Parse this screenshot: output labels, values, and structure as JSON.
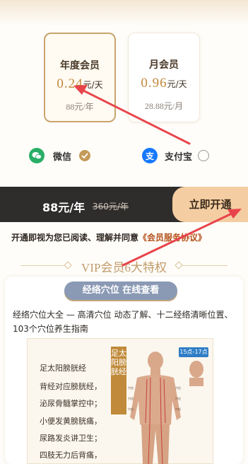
{
  "plans": [
    {
      "name": "年度会员",
      "price_num": "0.24",
      "price_unit": "元/天",
      "orig": "88元/年",
      "selected": true
    },
    {
      "name": "月会员",
      "price_num": "0.96",
      "price_unit": "元/天",
      "orig": "28.88元/月",
      "selected": false
    }
  ],
  "payment": {
    "wechat": {
      "label": "微信",
      "icon": "wechat-icon",
      "checked": true
    },
    "alipay": {
      "label": "支付宝",
      "icon_glyph": "支",
      "checked": false
    }
  },
  "purchase": {
    "price": "88元/年",
    "orig": "360元/年",
    "button": "立即开通"
  },
  "agreement": {
    "text": "开通即视为您已阅读、理解并同意",
    "link": "《会员服务协议》"
  },
  "privileges": {
    "title": "VIP会员6大特权"
  },
  "feature": {
    "pill": "经络穴位  在线查看",
    "description": "经络穴位大全 — 高清穴位  动态了解、十二经络清晰位置、103个穴位养生指南",
    "poster": {
      "lines": [
        "足太阳膀胱经",
        "背经对应膀胱经，",
        "泌尿骨髓掌控中；",
        "小便发黄膀胱痛，",
        "尿路发炎讲卫生；",
        "四肢无力后背痛，"
      ],
      "vertical_title": "足太阳膀胱经",
      "time_tag": "15点-17点"
    }
  },
  "colors": {
    "accent_gold": "#c9a46d",
    "price": "#c2893d",
    "dark_bar": "#2f2c2c",
    "cta": "#f4cea2",
    "link": "#b4531c",
    "arrow": "#e8444b"
  }
}
